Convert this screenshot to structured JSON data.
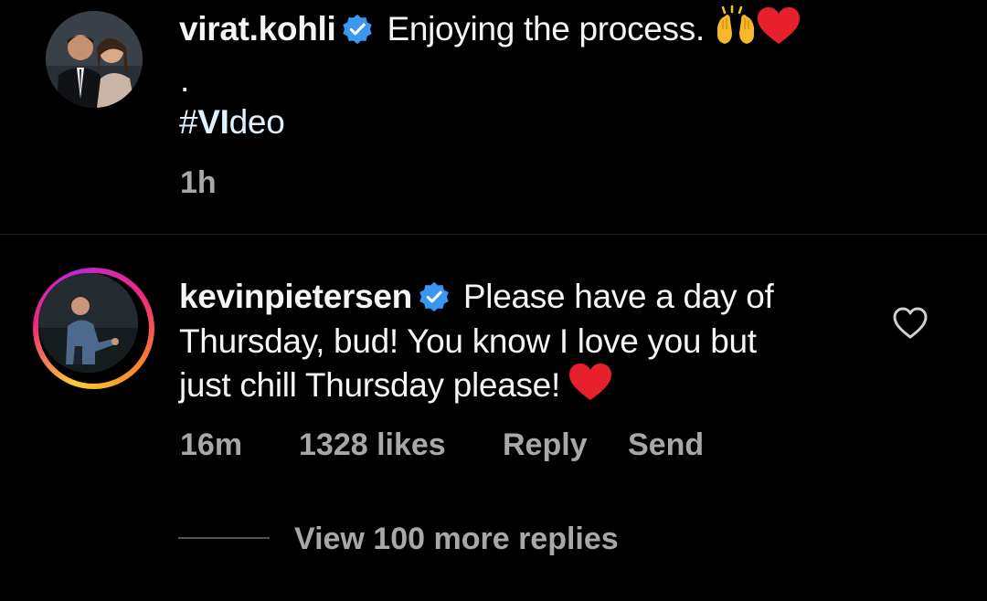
{
  "post": {
    "username": "virat.kohli",
    "caption": "Enjoying the process.",
    "dot": ".",
    "hashtag_prefix": "#",
    "hashtag_bold": "VI",
    "hashtag_rest": "deo",
    "time": "1h",
    "emojis": [
      "raised-hands",
      "red-heart"
    ]
  },
  "comment": {
    "username": "kevinpietersen",
    "text_line1": "Please have a day of",
    "text_line2": "Thursday, bud! You know I love you but",
    "text_line3": "just chill Thursday please!",
    "time": "16m",
    "likes": "1328 likes",
    "reply_label": "Reply",
    "send_label": "Send",
    "view_replies": "View 100 more replies",
    "emoji": "red-heart"
  },
  "colors": {
    "background": "#000000",
    "text": "#f5f5f5",
    "meta": "#a8a8a8",
    "verified_blue": "#3897f0",
    "heart_red": "#e8202c"
  }
}
